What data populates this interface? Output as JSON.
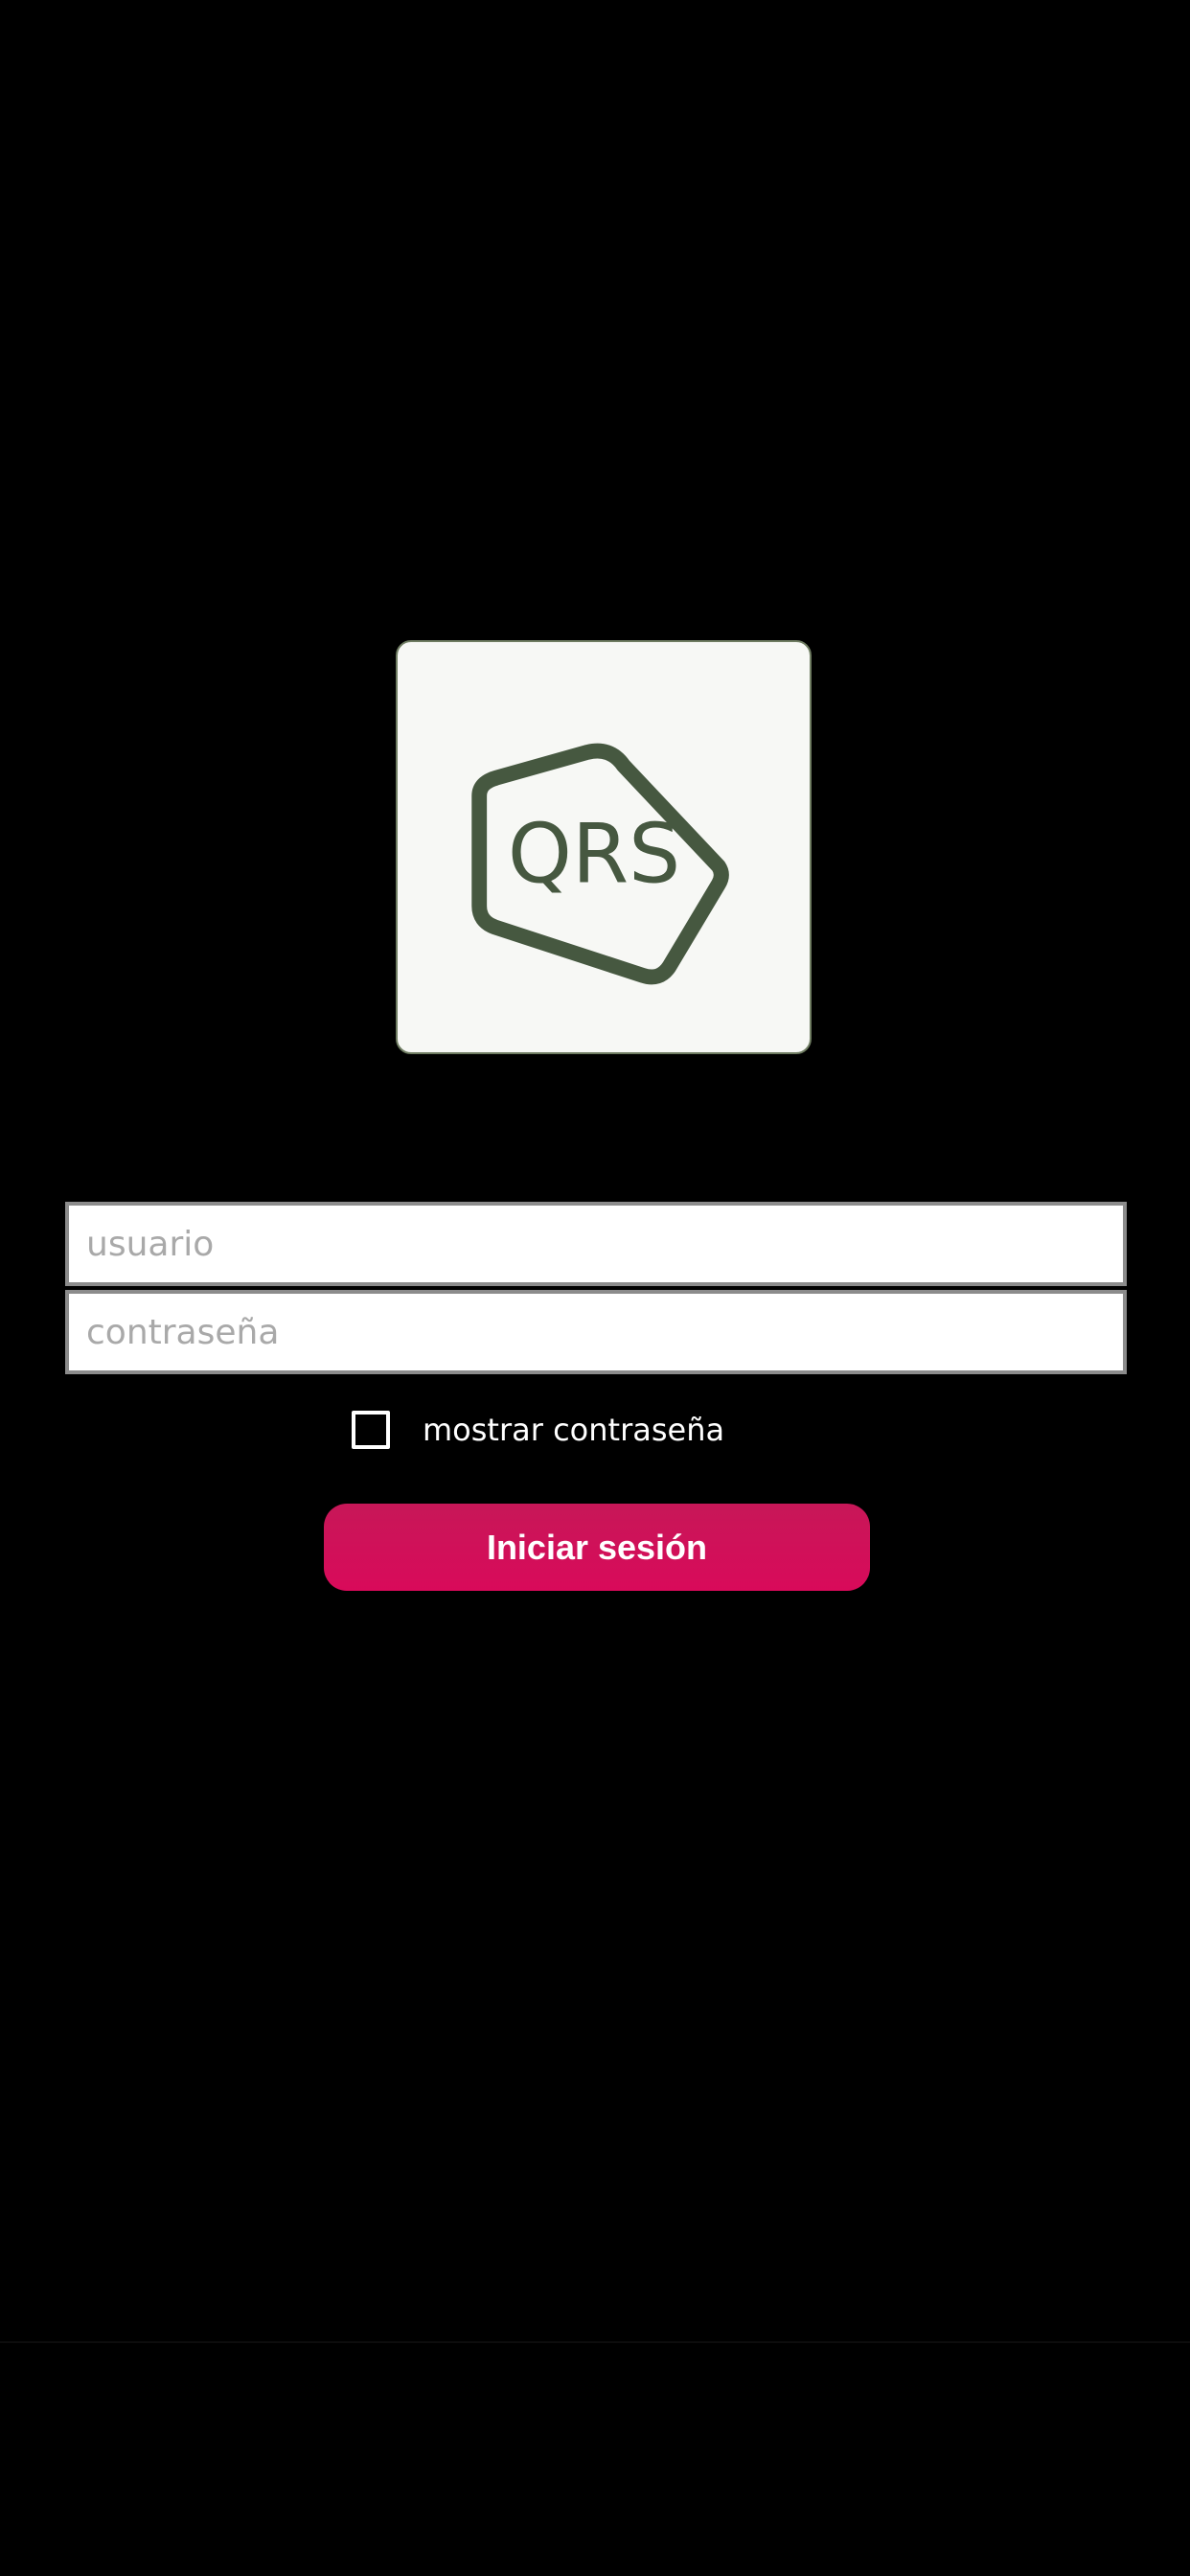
{
  "logo": {
    "text": "QRS",
    "brand_color": "#465840"
  },
  "login_form": {
    "username_placeholder": "usuario",
    "password_placeholder": "contraseña",
    "show_password_label": "mostrar contraseña",
    "show_password_checked": false,
    "submit_label": "Iniciar sesión"
  },
  "colors": {
    "background": "#000000",
    "button": "#d50b5a",
    "field_border": "#8c8c8c"
  }
}
